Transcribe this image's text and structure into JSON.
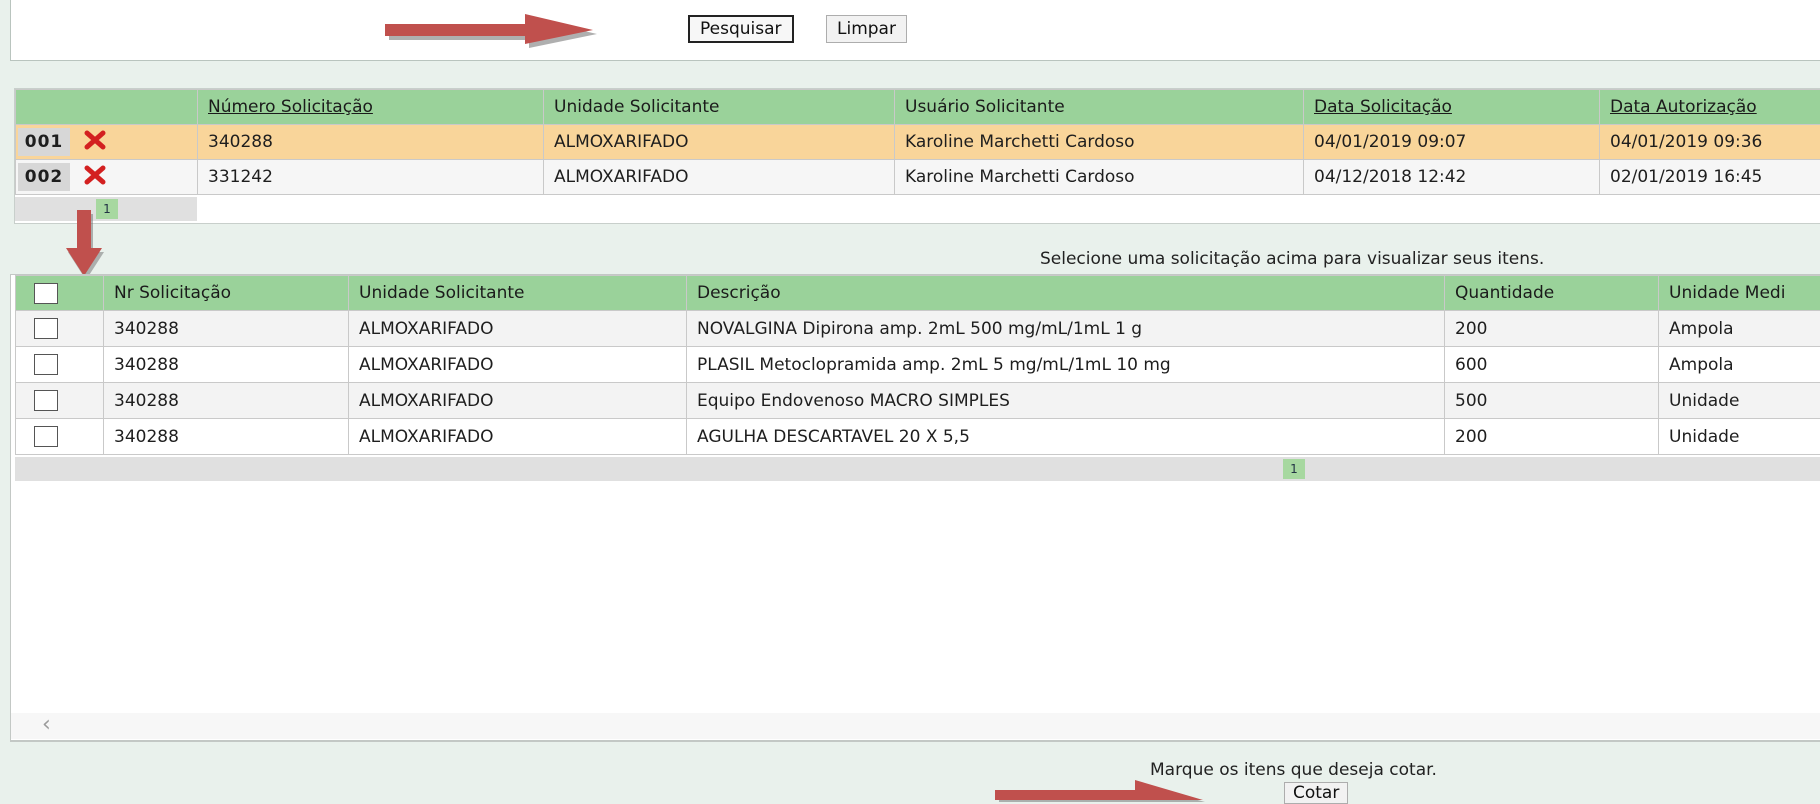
{
  "search": {
    "search_label": "Pesquisar",
    "clear_label": "Limpar"
  },
  "requests_grid": {
    "headers": [
      "",
      "Número Solicitação",
      "Unidade Solicitante",
      "Usuário Solicitante",
      "Data Solicitação",
      "Data Autorização"
    ],
    "rows": [
      {
        "num": "001",
        "numero": "340288",
        "unidade": "ALMOXARIFADO",
        "usuario": "Karoline Marchetti Cardoso",
        "data_solicitacao": "04/01/2019 09:07",
        "data_autorizacao": "04/01/2019 09:36"
      },
      {
        "num": "002",
        "numero": "331242",
        "unidade": "ALMOXARIFADO",
        "usuario": "Karoline Marchetti Cardoso",
        "data_solicitacao": "04/12/2018 12:42",
        "data_autorizacao": "02/01/2019 16:45"
      }
    ],
    "page": "1"
  },
  "items_hint": "Selecione uma solicitação acima para visualizar seus itens.",
  "items_grid": {
    "headers": [
      "Nr Solicitação",
      "Unidade Solicitante",
      "Descrição",
      "Quantidade",
      "Unidade Medi"
    ],
    "rows": [
      {
        "nr": "340288",
        "unidade": "ALMOXARIFADO",
        "descricao": "NOVALGINA Dipirona amp. 2mL 500 mg/mL/1mL 1 g",
        "quantidade": "200",
        "medida": "Ampola"
      },
      {
        "nr": "340288",
        "unidade": "ALMOXARIFADO",
        "descricao": "PLASIL Metoclopramida amp. 2mL 5 mg/mL/1mL 10 mg",
        "quantidade": "600",
        "medida": "Ampola"
      },
      {
        "nr": "340288",
        "unidade": "ALMOXARIFADO",
        "descricao": "Equipo Endovenoso MACRO SIMPLES",
        "quantidade": "500",
        "medida": "Unidade"
      },
      {
        "nr": "340288",
        "unidade": "ALMOXARIFADO",
        "descricao": "AGULHA DESCARTAVEL 20 X 5,5",
        "quantidade": "200",
        "medida": "Unidade"
      }
    ],
    "page": "1"
  },
  "footer": {
    "hint": "Marque os itens que deseja cotar.",
    "quote_label": "Cotar"
  },
  "colors": {
    "header_green": "#9ad29a",
    "selected_row": "#f9d59a",
    "annotation_arrow": "#c0504d"
  },
  "icons": {
    "delete": "delete-x-icon",
    "arrow": "annotation-arrow",
    "scroll": "scroll-left-icon"
  }
}
